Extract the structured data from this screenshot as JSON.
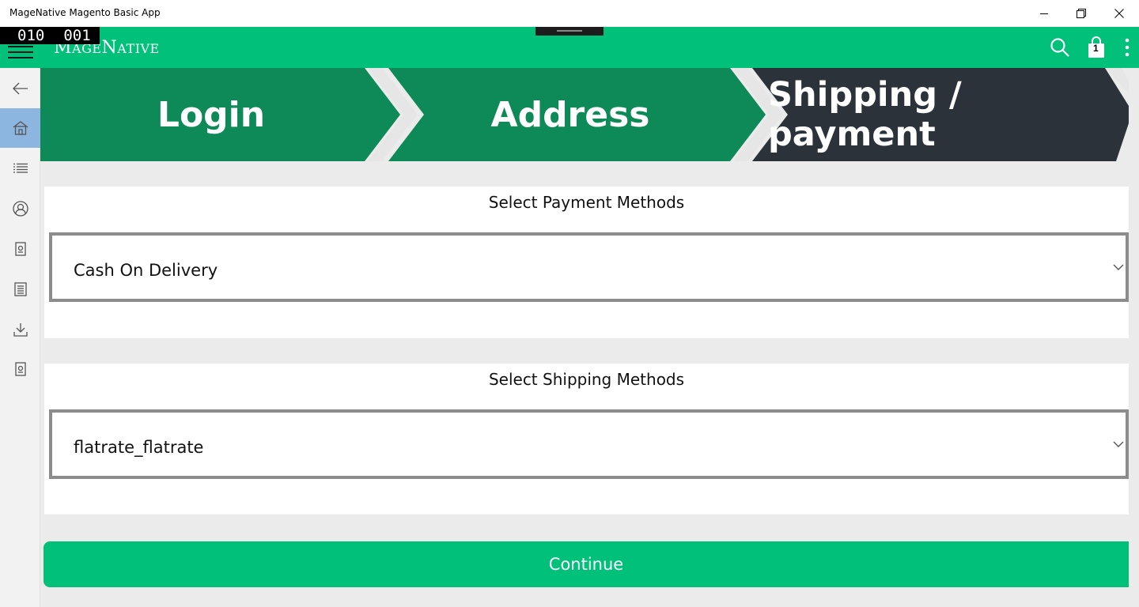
{
  "window": {
    "title": "MageNative Magento Basic App"
  },
  "header": {
    "counter_left": "010",
    "counter_right": "001",
    "logo_first": "M",
    "logo_first_rest": "AGE",
    "logo_second": "N",
    "logo_second_rest": "ATIVE",
    "cart_count": "1",
    "accent_color": "#00c07a"
  },
  "sidebar": {
    "items": [
      {
        "icon": "back-arrow-icon"
      },
      {
        "icon": "home-icon",
        "active": true
      },
      {
        "icon": "list-icon"
      },
      {
        "icon": "account-icon"
      },
      {
        "icon": "page-icon"
      },
      {
        "icon": "document-list-icon"
      },
      {
        "icon": "download-icon"
      },
      {
        "icon": "page-icon"
      }
    ]
  },
  "steps": [
    {
      "label": "Login",
      "color": "#0d8a57"
    },
    {
      "label": "Address",
      "color": "#0d8a57"
    },
    {
      "label": "Shipping / payment",
      "color": "#2b323a"
    }
  ],
  "payment": {
    "title": "Select Payment Methods",
    "selected": "Cash On Delivery"
  },
  "shipping": {
    "title": "Select Shipping Methods",
    "selected": "flatrate_flatrate"
  },
  "continue_label": "Continue"
}
